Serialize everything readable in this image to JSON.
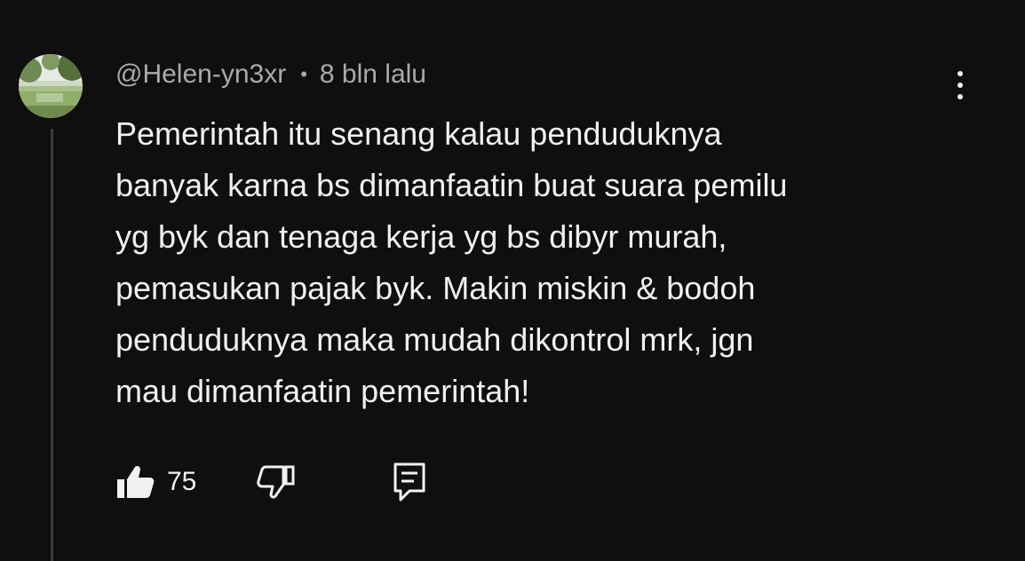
{
  "comment": {
    "author": "@Helen-yn3xr",
    "separator": "•",
    "timestamp": "8 bln lalu",
    "lines": [
      "Pemerintah itu senang kalau penduduknya",
      "banyak karna bs dimanfaatin buat suara pemilu",
      "yg byk dan tenaga kerja yg bs dibyr murah,",
      "pemasukan pajak byk. Makin miskin & bodoh",
      "penduduknya maka mudah dikontrol mrk, jgn",
      "mau dimanfaatin pemerintah!"
    ],
    "like_count": "75"
  },
  "icons": {
    "avatar": "avatar-photo-landscape",
    "more": "more-vertical-icon",
    "like": "thumbs-up-filled-icon",
    "dislike": "thumbs-down-outline-icon",
    "reply": "reply-comment-icon"
  },
  "colors": {
    "background": "#0f0f0f",
    "primary_text": "#f1f1f1",
    "secondary_text": "#aaaaaa",
    "thread_line": "#3a3a3a"
  }
}
